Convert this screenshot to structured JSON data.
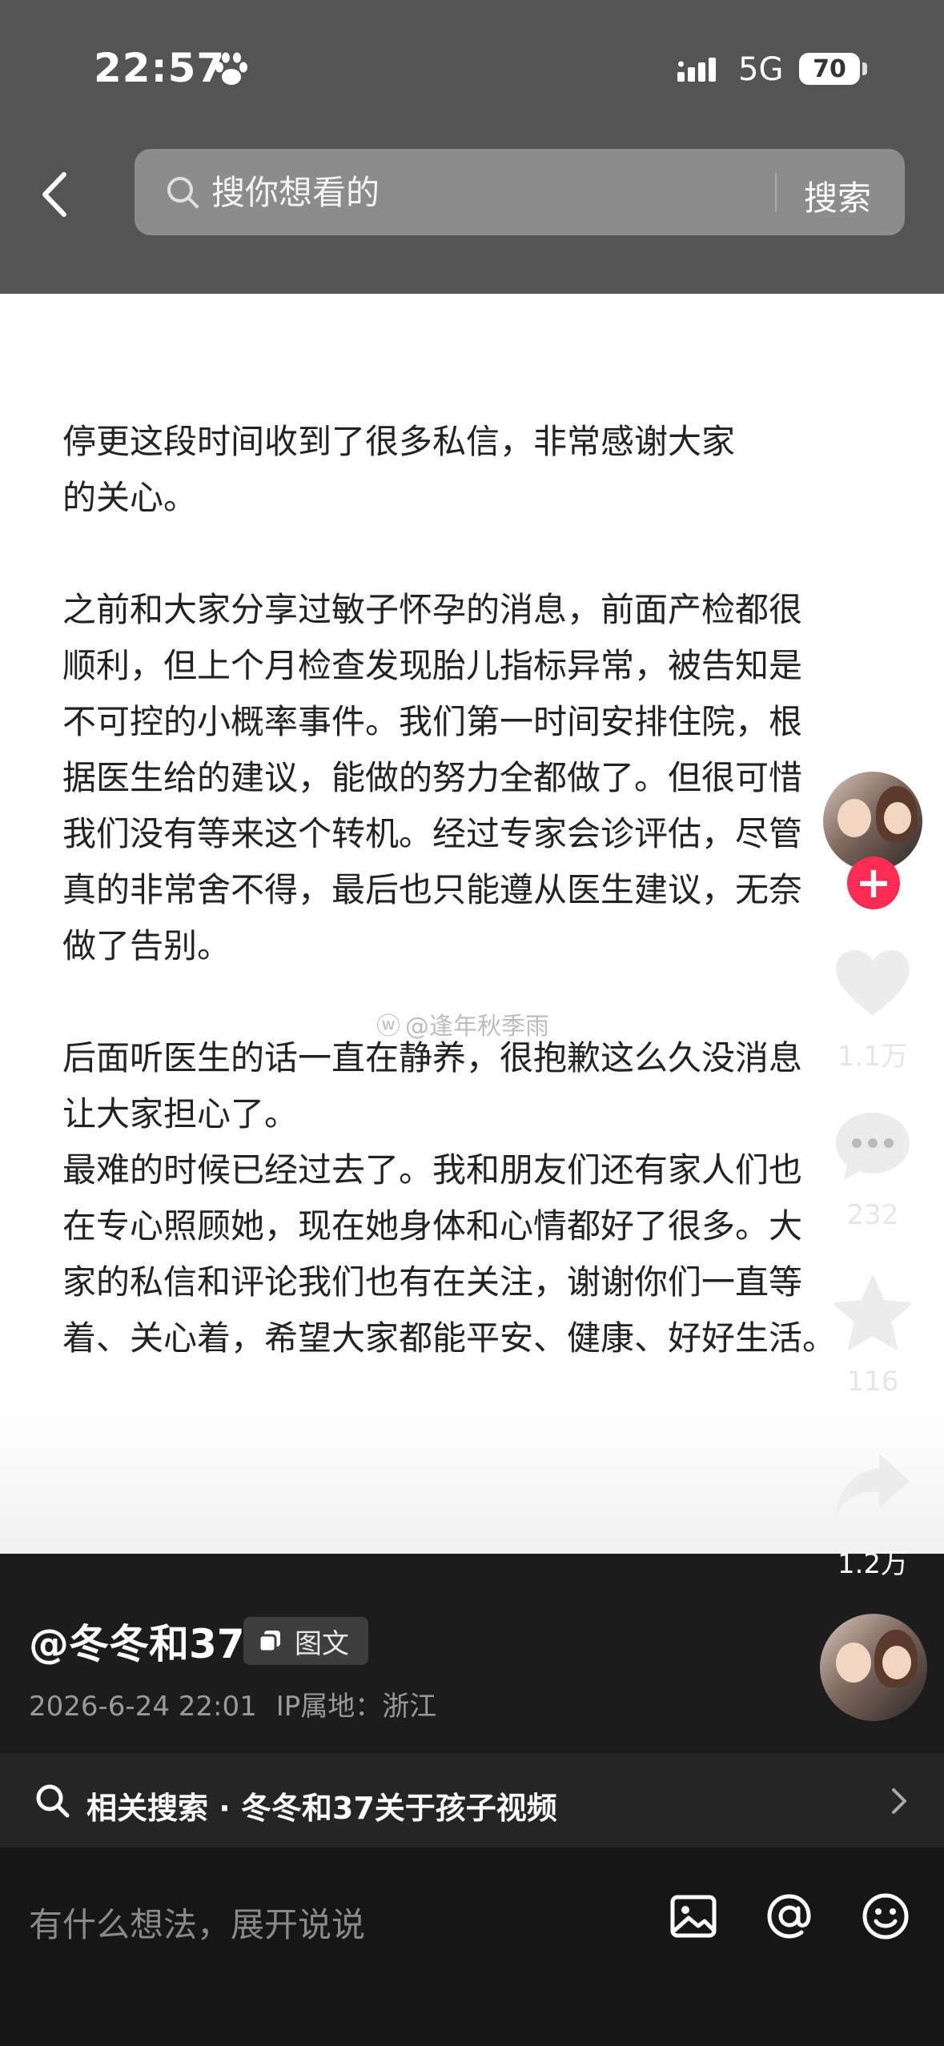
{
  "status_bar": {
    "time": "22:57",
    "network": "5G",
    "battery": "70"
  },
  "header": {
    "search_placeholder": "搜你想看的",
    "search_button": "搜索"
  },
  "post": {
    "paragraphs": [
      "停更这段时间收到了很多私信，非常感谢大家\n的关心。",
      "之前和大家分享过敏子怀孕的消息，前面产检都很\n顺利，但上个月检查发现胎儿指标异常，被告知是\n不可控的小概率事件。我们第一时间安排住院，根\n据医生给的建议，能做的努力全都做了。但很可惜\n我们没有等来这个转机。经过专家会诊评估，尽管\n真的非常舍不得，最后也只能遵从医生建议，无奈\n做了告别。",
      "后面听医生的话一直在静养，很抱歉这么久没消息\n让大家担心了。",
      "最难的时候已经过去了。我和朋友们还有家人们也\n在专心照顾她，现在她身体和心情都好了很多。大\n家的私信和评论我们也有在关注，谢谢你们一直等\n着、关心着，希望大家都能平安、健康、好好生活。"
    ],
    "watermark": "@逢年秋季雨"
  },
  "actions": {
    "likes": "1.1万",
    "comments": "232",
    "favorites": "116",
    "shares": "1.2万"
  },
  "info": {
    "author": "@冬冬和37",
    "tag": "图文",
    "date": "2026-6-24 22:01",
    "location": "IP属地：浙江"
  },
  "related": {
    "text": "相关搜索 · 冬冬和37关于孩子视频"
  },
  "comment": {
    "placeholder": "有什么想法，展开说说"
  }
}
